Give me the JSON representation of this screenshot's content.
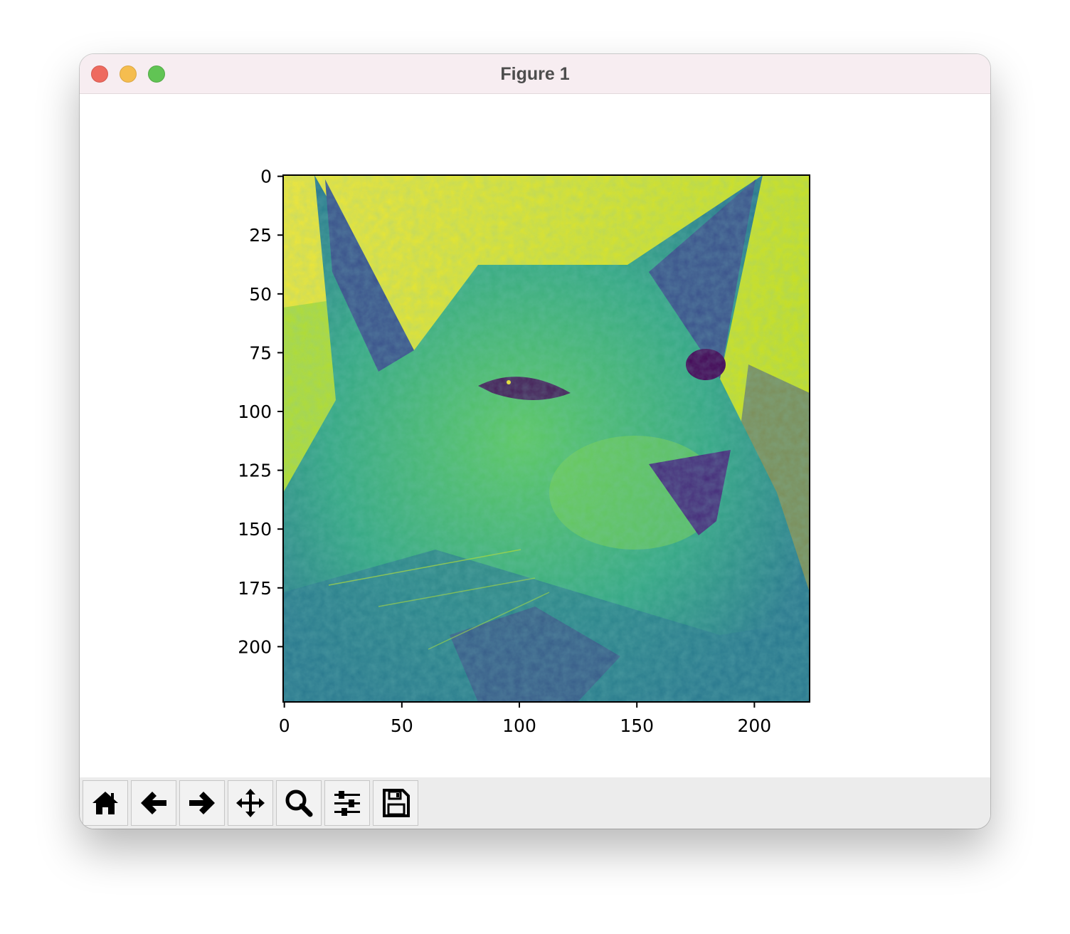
{
  "window": {
    "title": "Figure 1"
  },
  "toolbar": {
    "buttons": [
      {
        "id": "home",
        "icon": "home-icon"
      },
      {
        "id": "back",
        "icon": "arrow-left-icon"
      },
      {
        "id": "forward",
        "icon": "arrow-right-icon"
      },
      {
        "id": "pan",
        "icon": "move-arrows-icon"
      },
      {
        "id": "zoom",
        "icon": "magnifier-icon"
      },
      {
        "id": "configure",
        "icon": "sliders-icon"
      },
      {
        "id": "save",
        "icon": "floppy-disk-icon"
      }
    ]
  },
  "chart_data": {
    "type": "heatmap",
    "colormap": "viridis",
    "x_ticks": [
      "0",
      "50",
      "100",
      "150",
      "200"
    ],
    "y_ticks": [
      "0",
      "25",
      "50",
      "75",
      "100",
      "125",
      "150",
      "175",
      "200"
    ],
    "xlim": [
      -0.5,
      223.5
    ],
    "ylim": [
      223.5,
      -0.5
    ],
    "image_size": [
      224,
      224
    ],
    "grid": false
  }
}
